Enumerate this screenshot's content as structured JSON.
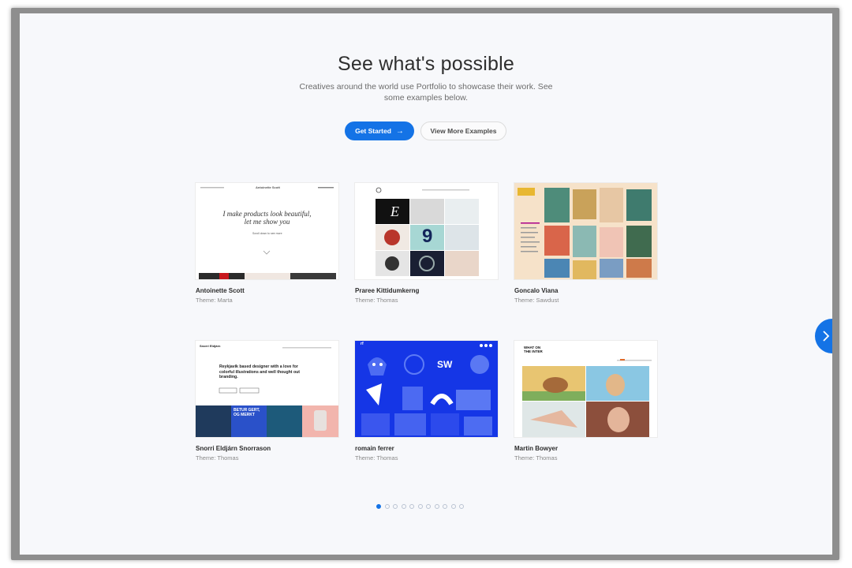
{
  "hero": {
    "title": "See what's possible",
    "subtitle": "Creatives around the world use Portfolio to showcase their work. See some examples below.",
    "primary_button": "Get Started",
    "primary_button_arrow": "→",
    "secondary_button": "View More Examples"
  },
  "cards": [
    {
      "name": "Antoinette Scott",
      "theme": "Theme: Marta",
      "preview_site": "Antoinette Scott",
      "preview_headline": "I make products look beautiful, let me show you",
      "preview_sub": "Scroll down to see more"
    },
    {
      "name": "Praree Kittidumkerng",
      "theme": "Theme: Thomas",
      "preview_letter": "9"
    },
    {
      "name": "Goncalo Viana",
      "theme": "Theme: Sawdust"
    },
    {
      "name": "Snorri Eldjárn Snorrason",
      "theme": "Theme: Thomas",
      "preview_logo": "Snorri Eldjárn",
      "preview_headline": "Reykjavik based designer with a love for colorful illustrations and well thought out branding.",
      "preview_poster": "BETUR GERT, OG MERKT"
    },
    {
      "name": "romain ferrer",
      "theme": "Theme: Thomas",
      "preview_logo": "rf"
    },
    {
      "name": "Martin Bowyer",
      "theme": "Theme: Thomas",
      "preview_logo": "WHAT ON THE INTER"
    }
  ],
  "carousel": {
    "next_icon": "chevron-right-icon",
    "dot_count": 11,
    "active_index": 0
  },
  "colors": {
    "accent": "#1473e6",
    "page_bg": "#f7f8fb"
  }
}
